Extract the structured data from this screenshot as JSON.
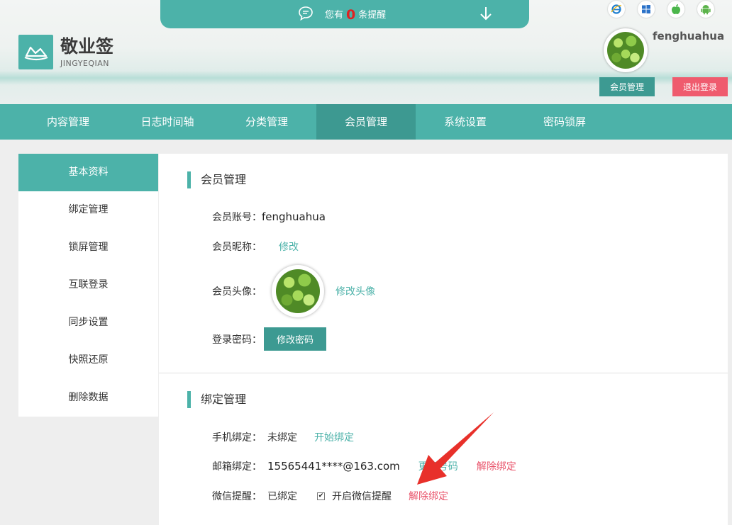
{
  "brand": {
    "title": "敬业签",
    "subtitle": "JINGYEQIAN"
  },
  "notice": {
    "prefix": "您有",
    "count": "0",
    "suffix": "条提醒"
  },
  "platforms": [
    "ie-icon",
    "windows-icon",
    "apple-icon",
    "android-icon"
  ],
  "user": {
    "name": "fenghuahua",
    "member_btn": "会员管理",
    "logout_btn": "退出登录"
  },
  "nav": {
    "items": [
      {
        "label": "内容管理"
      },
      {
        "label": "日志时间轴"
      },
      {
        "label": "分类管理"
      },
      {
        "label": "会员管理"
      },
      {
        "label": "系统设置"
      },
      {
        "label": "密码锁屏"
      }
    ]
  },
  "sidebar": {
    "items": [
      {
        "label": "基本资料"
      },
      {
        "label": "绑定管理"
      },
      {
        "label": "锁屏管理"
      },
      {
        "label": "互联登录"
      },
      {
        "label": "同步设置"
      },
      {
        "label": "快照还原"
      },
      {
        "label": "删除数据"
      }
    ]
  },
  "member": {
    "title": "会员管理",
    "account_label": "会员账号：",
    "account_value": "fenghuahua",
    "nickname_label": "会员昵称：",
    "nickname_link": "修改",
    "avatar_label": "会员头像：",
    "avatar_link": "修改头像",
    "password_label": "登录密码：",
    "password_btn": "修改密码"
  },
  "binding": {
    "title": "绑定管理",
    "phone_label": "手机绑定：",
    "phone_status": "未绑定",
    "phone_link": "开始绑定",
    "email_label": "邮箱绑定：",
    "email_value": "15565441****@163.com",
    "email_change": "更换号码",
    "email_unbind": "解除绑定",
    "wechat_label": "微信提醒：",
    "wechat_status": "已绑定",
    "wechat_checkbox": "开启微信提醒",
    "wechat_unbind": "解除绑定"
  },
  "colors": {
    "accent": "#4cb2a9",
    "accent_dark": "#3d9a92",
    "danger": "#ef5b6e",
    "link_red": "#e9546b"
  }
}
